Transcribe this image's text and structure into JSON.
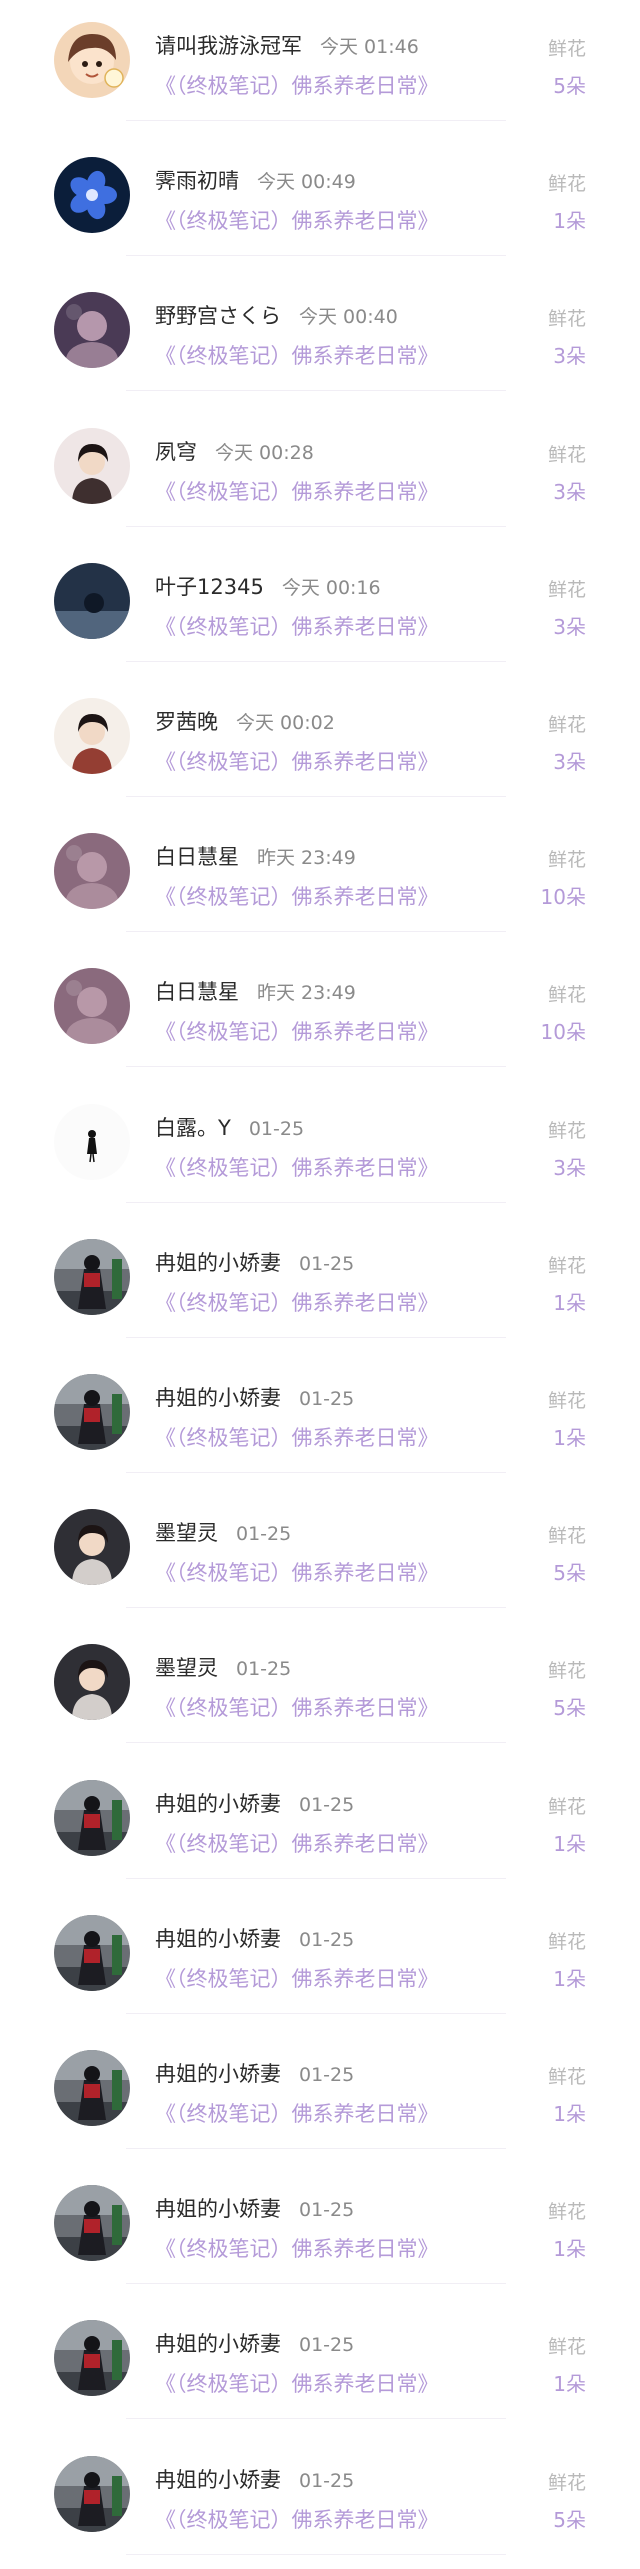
{
  "list": {
    "rows": [
      {
        "name": "请叫我游泳冠军",
        "time": "今天 01:46",
        "book": "《（终极笔记）佛系养老日常》",
        "gift": "鲜花",
        "count": "5朵",
        "avatar": {
          "style": "cartoon",
          "bg": "#f3d6b8",
          "fg": "#6b3e2a"
        }
      },
      {
        "name": "霁雨初晴",
        "time": "今天 00:49",
        "book": "《（终极笔记）佛系养老日常》",
        "gift": "鲜花",
        "count": "1朵",
        "avatar": {
          "style": "flower",
          "bg": "#0b1e3a",
          "fg": "#3f6fe0"
        }
      },
      {
        "name": "野野宫さくら",
        "time": "今天 00:40",
        "book": "《（终极笔记）佛系养老日常》",
        "gift": "鲜花",
        "count": "3朵",
        "avatar": {
          "style": "photo",
          "bg": "#4a3a55",
          "fg": "#d9b7c9"
        }
      },
      {
        "name": "夙穹",
        "time": "今天 00:28",
        "book": "《（终极笔记）佛系养老日常》",
        "gift": "鲜花",
        "count": "3朵",
        "avatar": {
          "style": "portrait",
          "bg": "#efe6e6",
          "fg": "#2a1b1b"
        }
      },
      {
        "name": "叶子12345",
        "time": "今天 00:16",
        "book": "《（终极笔记）佛系养老日常》",
        "gift": "鲜花",
        "count": "3朵",
        "avatar": {
          "style": "dark",
          "bg": "#233247",
          "fg": "#51657d"
        }
      },
      {
        "name": "罗茜晚",
        "time": "今天 00:02",
        "book": "《（终极笔记）佛系养老日常》",
        "gift": "鲜花",
        "count": "3朵",
        "avatar": {
          "style": "portrait",
          "bg": "#f5efe9",
          "fg": "#8a2a1f"
        }
      },
      {
        "name": "白日慧星",
        "time": "昨天 23:49",
        "book": "《（终极笔记）佛系养老日常》",
        "gift": "鲜花",
        "count": "10朵",
        "avatar": {
          "style": "photo",
          "bg": "#8a6a7d",
          "fg": "#c7a8b7"
        }
      },
      {
        "name": "白日慧星",
        "time": "昨天 23:49",
        "book": "《（终极笔记）佛系养老日常》",
        "gift": "鲜花",
        "count": "10朵",
        "avatar": {
          "style": "photo",
          "bg": "#8a6a7d",
          "fg": "#c7a8b7"
        }
      },
      {
        "name": "白露。Y",
        "time": "01-25",
        "book": "《（终极笔记）佛系养老日常》",
        "gift": "鲜花",
        "count": "3朵",
        "avatar": {
          "style": "figure",
          "bg": "#fbfbfb",
          "fg": "#111111"
        }
      },
      {
        "name": "冉姐的小娇妻",
        "time": "01-25",
        "book": "《（终极笔记）佛系养老日常》",
        "gift": "鲜花",
        "count": "1朵",
        "avatar": {
          "style": "street",
          "bg": "#6a6e74",
          "fg": "#b0222a"
        }
      },
      {
        "name": "冉姐的小娇妻",
        "time": "01-25",
        "book": "《（终极笔记）佛系养老日常》",
        "gift": "鲜花",
        "count": "1朵",
        "avatar": {
          "style": "street",
          "bg": "#6a6e74",
          "fg": "#b0222a"
        }
      },
      {
        "name": "墨望灵",
        "time": "01-25",
        "book": "《（终极笔记）佛系养老日常》",
        "gift": "鲜花",
        "count": "5朵",
        "avatar": {
          "style": "portrait",
          "bg": "#2f2f35",
          "fg": "#e6e0dc"
        }
      },
      {
        "name": "墨望灵",
        "time": "01-25",
        "book": "《（终极笔记）佛系养老日常》",
        "gift": "鲜花",
        "count": "5朵",
        "avatar": {
          "style": "portrait",
          "bg": "#2f2f35",
          "fg": "#e6e0dc"
        }
      },
      {
        "name": "冉姐的小娇妻",
        "time": "01-25",
        "book": "《（终极笔记）佛系养老日常》",
        "gift": "鲜花",
        "count": "1朵",
        "avatar": {
          "style": "street",
          "bg": "#6a6e74",
          "fg": "#b0222a"
        }
      },
      {
        "name": "冉姐的小娇妻",
        "time": "01-25",
        "book": "《（终极笔记）佛系养老日常》",
        "gift": "鲜花",
        "count": "1朵",
        "avatar": {
          "style": "street",
          "bg": "#6a6e74",
          "fg": "#b0222a"
        }
      },
      {
        "name": "冉姐的小娇妻",
        "time": "01-25",
        "book": "《（终极笔记）佛系养老日常》",
        "gift": "鲜花",
        "count": "1朵",
        "avatar": {
          "style": "street",
          "bg": "#6a6e74",
          "fg": "#b0222a"
        }
      },
      {
        "name": "冉姐的小娇妻",
        "time": "01-25",
        "book": "《（终极笔记）佛系养老日常》",
        "gift": "鲜花",
        "count": "1朵",
        "avatar": {
          "style": "street",
          "bg": "#6a6e74",
          "fg": "#b0222a"
        }
      },
      {
        "name": "冉姐的小娇妻",
        "time": "01-25",
        "book": "《（终极笔记）佛系养老日常》",
        "gift": "鲜花",
        "count": "1朵",
        "avatar": {
          "style": "street",
          "bg": "#6a6e74",
          "fg": "#b0222a"
        }
      },
      {
        "name": "冉姐的小娇妻",
        "time": "01-25",
        "book": "《（终极笔记）佛系养老日常》",
        "gift": "鲜花",
        "count": "5朵",
        "avatar": {
          "style": "street",
          "bg": "#6a6e74",
          "fg": "#b0222a"
        }
      }
    ]
  }
}
